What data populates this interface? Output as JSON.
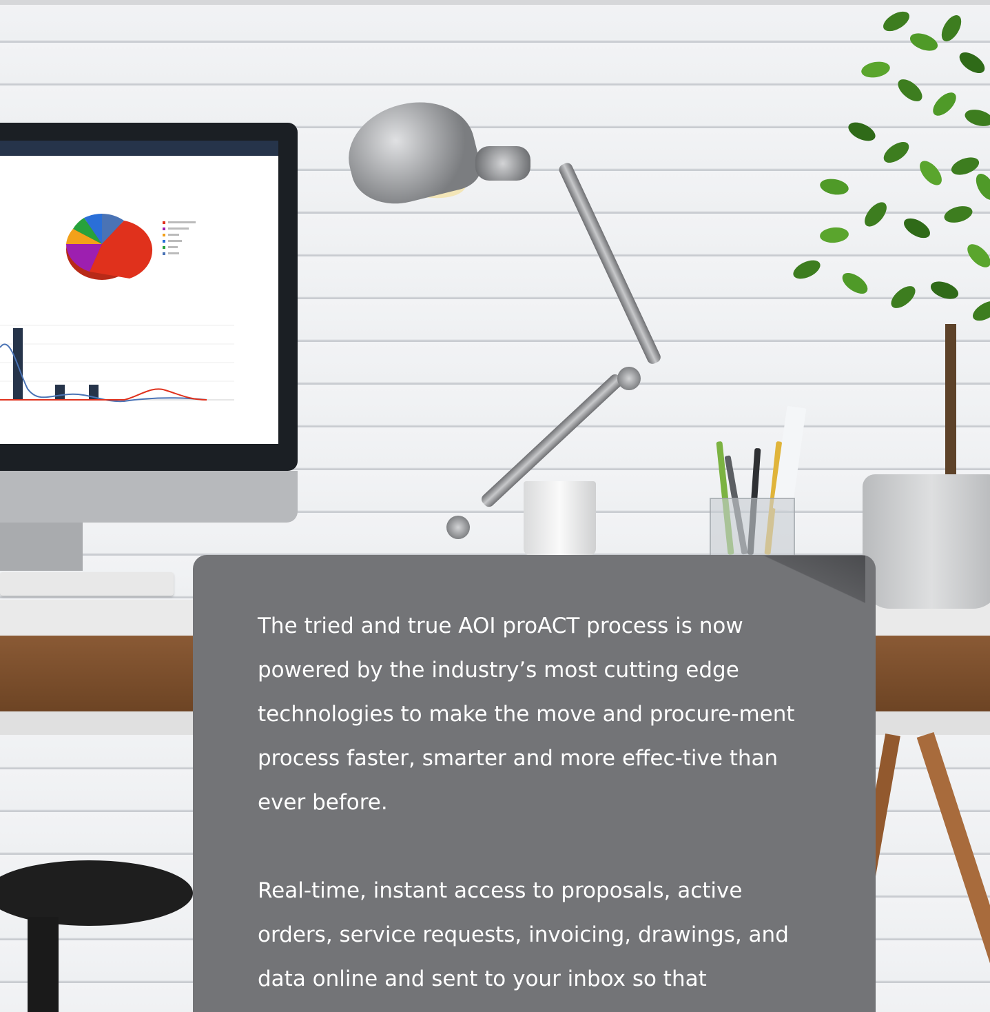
{
  "card": {
    "paragraph_1": "The tried and true AOI proACT process is now powered by the industry’s most cutting edge technologies to make the move and procure-ment process faster, smarter and more effec-tive than ever before.",
    "paragraph_2": "Real-time, instant access to proposals, active orders, service requests, invoicing, drawings, and data online and sent to your inbox so that"
  },
  "colors": {
    "card_bg": "#737477",
    "card_text": "#ffffff"
  }
}
